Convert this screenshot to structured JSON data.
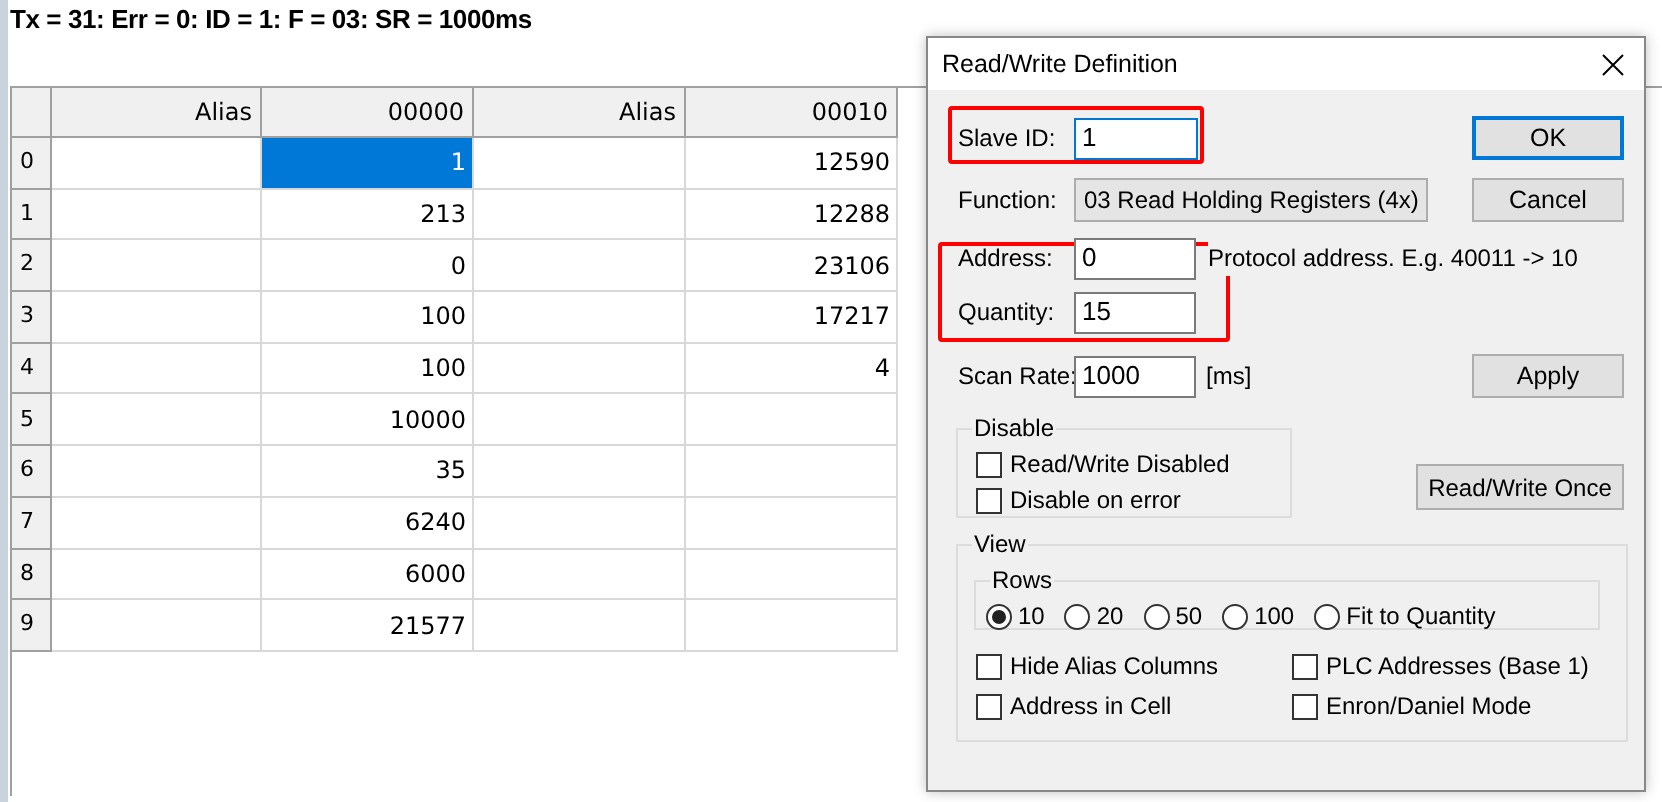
{
  "status_bar": {
    "text": "Tx = 31: Err = 0: ID = 1: F = 03: SR = 1000ms"
  },
  "table": {
    "columns": [
      "Alias",
      "00000",
      "Alias",
      "00010"
    ],
    "rows": [
      {
        "header": "0",
        "cells": [
          {
            "selected": false
          },
          {
            "text": "1",
            "selected": true
          },
          {
            "selected": false
          },
          {
            "text": "12590",
            "selected": false
          }
        ]
      },
      {
        "header": "1",
        "cells": [
          {
            "selected": false
          },
          {
            "text": "213",
            "selected": false
          },
          {
            "selected": false
          },
          {
            "text": "12288",
            "selected": false
          }
        ]
      },
      {
        "header": "2",
        "cells": [
          {
            "selected": false
          },
          {
            "text": "0",
            "selected": false
          },
          {
            "selected": false
          },
          {
            "text": "23106",
            "selected": false
          }
        ]
      },
      {
        "header": "3",
        "cells": [
          {
            "selected": false
          },
          {
            "text": "100",
            "selected": false
          },
          {
            "selected": false
          },
          {
            "text": "17217",
            "selected": false
          }
        ]
      },
      {
        "header": "4",
        "cells": [
          {
            "selected": false
          },
          {
            "text": "100",
            "selected": false
          },
          {
            "selected": false
          },
          {
            "text": "4",
            "selected": false
          }
        ]
      },
      {
        "header": "5",
        "cells": [
          {
            "selected": false
          },
          {
            "text": "10000",
            "selected": false
          },
          {
            "selected": false
          },
          {
            "selected": false
          }
        ]
      },
      {
        "header": "6",
        "cells": [
          {
            "selected": false
          },
          {
            "text": "35",
            "selected": false
          },
          {
            "selected": false
          },
          {
            "selected": false
          }
        ]
      },
      {
        "header": "7",
        "cells": [
          {
            "selected": false
          },
          {
            "text": "6240",
            "selected": false
          },
          {
            "selected": false
          },
          {
            "selected": false
          }
        ]
      },
      {
        "header": "8",
        "cells": [
          {
            "selected": false
          },
          {
            "text": "6000",
            "selected": false
          },
          {
            "selected": false
          },
          {
            "selected": false
          }
        ]
      },
      {
        "header": "9",
        "cells": [
          {
            "selected": false
          },
          {
            "text": "21577",
            "selected": false
          },
          {
            "selected": false
          },
          {
            "selected": false
          }
        ]
      }
    ]
  },
  "dialog": {
    "title": "Read/Write Definition",
    "slave_id": {
      "label": "Slave ID:",
      "value": "1"
    },
    "function": {
      "label": "Function:",
      "value": "03 Read Holding Registers (4x)"
    },
    "address": {
      "label": "Address:",
      "value": "0",
      "hint": "Protocol address. E.g. 40011 -> 10"
    },
    "quantity": {
      "label": "Quantity:",
      "value": "15"
    },
    "scan_rate": {
      "label": "Scan Rate:",
      "value": "1000",
      "unit": "[ms]"
    },
    "buttons": {
      "ok": "OK",
      "cancel": "Cancel",
      "apply": "Apply",
      "once": "Read/Write Once"
    },
    "disable": {
      "title": "Disable",
      "options": [
        {
          "label": "Read/Write Disabled",
          "checked": false
        },
        {
          "label": "Disable on error",
          "checked": false
        }
      ]
    },
    "view": {
      "title": "View",
      "rows_title": "Rows",
      "rows_options": [
        {
          "label": "10",
          "selected": true
        },
        {
          "label": "20",
          "selected": false
        },
        {
          "label": "50",
          "selected": false
        },
        {
          "label": "100",
          "selected": false
        },
        {
          "label": "Fit to Quantity",
          "selected": false
        }
      ],
      "options": [
        {
          "label": "Hide Alias Columns",
          "checked": false
        },
        {
          "label": "PLC Addresses (Base 1)",
          "checked": false
        },
        {
          "label": "Address in Cell",
          "checked": false
        },
        {
          "label": "Enron/Daniel Mode",
          "checked": false
        }
      ]
    }
  }
}
